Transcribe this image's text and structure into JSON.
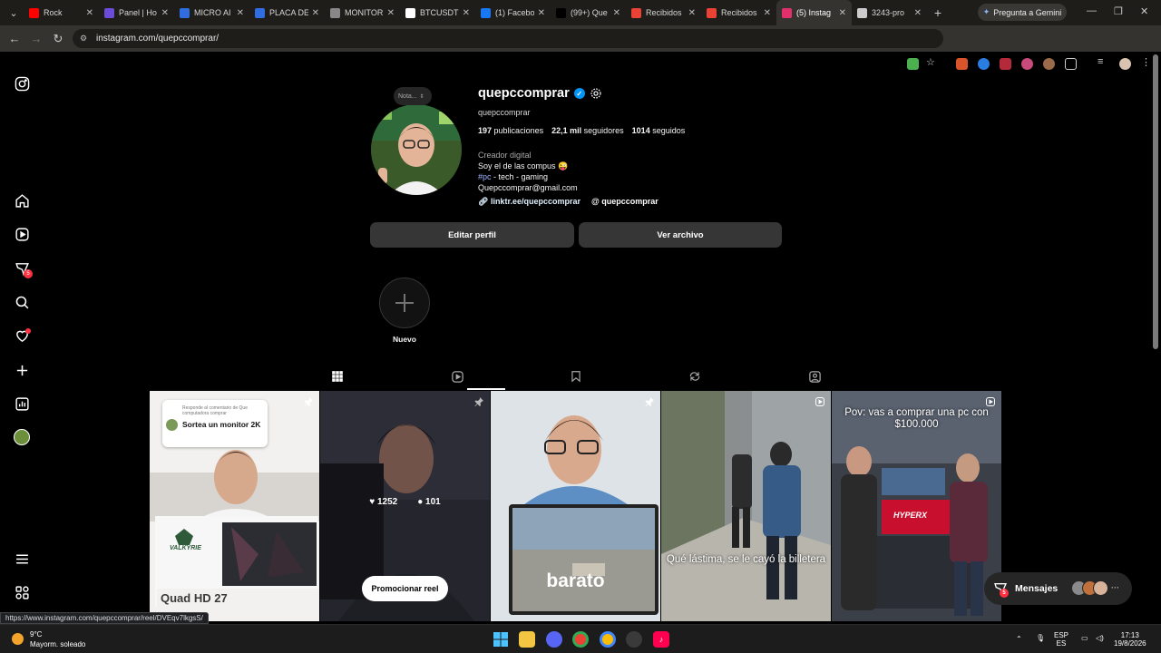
{
  "browser": {
    "tabs": [
      {
        "title": "Rock",
        "icon": "youtube-icon",
        "color": "#ff0000"
      },
      {
        "title": "Panel | Ho",
        "icon": "panel-icon",
        "color": "#6b4cd8"
      },
      {
        "title": "MICRO AI",
        "icon": "docs-icon",
        "color": "#2f6de1"
      },
      {
        "title": "PLACA DE",
        "icon": "docs-icon",
        "color": "#2f6de1"
      },
      {
        "title": "MONITOR",
        "icon": "monitor-icon",
        "color": "#888888"
      },
      {
        "title": "BTCUSDT",
        "icon": "tradingview-icon",
        "color": "#ffffff"
      },
      {
        "title": "(1) Facebo",
        "icon": "facebook-icon",
        "color": "#1877f2"
      },
      {
        "title": "(99+) Que",
        "icon": "tiktok-icon",
        "color": "#000000"
      },
      {
        "title": "Recibidos",
        "icon": "gmail-icon",
        "color": "#ea4335"
      },
      {
        "title": "Recibidos",
        "icon": "gmail-icon",
        "color": "#ea4335"
      },
      {
        "title": "(5) Instag",
        "icon": "instagram-icon",
        "color": "#e1306c",
        "active": true
      },
      {
        "title": "3243-pro",
        "icon": "document-icon",
        "color": "#cccccc"
      }
    ],
    "gemini_label": "Pregunta a Gemini",
    "url": "instagram.com/quepccomprar/",
    "status_url": "https://www.instagram.com/quepccomprar/reel/DVEqv7lkgsS/"
  },
  "sidebar": {
    "notifications_badge": "5"
  },
  "profile": {
    "username": "quepccomprar",
    "handle": "quepccomprar",
    "note_placeholder": "Nota...",
    "stats": {
      "posts": "197",
      "posts_label": "publicaciones",
      "followers": "22,1 mil",
      "followers_label": "seguidores",
      "following": "1014",
      "following_label": "seguidos"
    },
    "category": "Creador digital",
    "bio_line1": "Soy el de las compus 😜",
    "bio_hashtag": "#pc",
    "bio_line2_rest": " - tech - gaming",
    "bio_email": "Quepccomprar@gmail.com",
    "link": "linktr.ee/quepccomprar",
    "threads": "quepccomprar",
    "edit_label": "Editar perfil",
    "archive_label": "Ver archivo",
    "story_new_label": "Nuevo"
  },
  "posts": [
    {
      "caption_small": "Responde al comentario de Que computadora comprar",
      "caption": "Sortea un monitor 2K",
      "footer": "Quad HD 27",
      "brand": "VALKYRIE"
    },
    {
      "likes": "1252",
      "comments": "101",
      "promote": "Promocionar reel"
    },
    {
      "caption": "barato"
    },
    {
      "caption": "Qué lástima, se le cayó la billetera"
    },
    {
      "caption": "Pov: vas a comprar una pc con $100.000",
      "store": "HYPERX"
    }
  ],
  "messages": {
    "label": "Mensajes",
    "badge": "5"
  },
  "taskbar": {
    "temp": "9°C",
    "weather": "Mayorm. soleado",
    "lang_top": "ESP",
    "lang_bottom": "ES",
    "time": "17:13",
    "date": "19/8/2026"
  }
}
